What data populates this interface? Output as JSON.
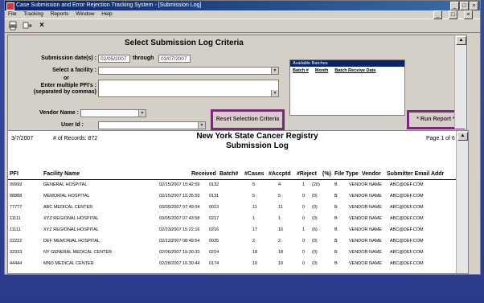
{
  "window": {
    "title": "Case Submission and Error Rejection Tracking System - [Submission Log]"
  },
  "menu": {
    "items": [
      "File",
      "Tracking",
      "Reports",
      "Window",
      "Help"
    ]
  },
  "toolbar": {
    "print_icon": "printer-icon",
    "refresh_icon": "refresh-icon",
    "close_glyph": "×"
  },
  "criteria": {
    "title": "Select Submission Log Criteria",
    "date_label": "Submission date(s) :",
    "date_from": "02/05/2007",
    "through_label": "through",
    "date_to": "03/07/2007",
    "facility_label": "Select a facility :",
    "or_label": "or",
    "pfi_label_1": "Enter multiple PFI's :",
    "pfi_label_2": "(separated by commas)",
    "vendor_label": "Vendor Name :",
    "user_label": "User Id :",
    "batches": {
      "header": "Available Batches",
      "col1": "Batch #",
      "col2": "Month",
      "col3": "Batch Receive Date"
    },
    "reset_label": "Reset Selection Criteria",
    "run_label": "* Run Report *"
  },
  "report": {
    "date": "3/7/2007",
    "records_label": "# of Records:",
    "records_value": "872",
    "title_line1": "New York State Cancer Registry",
    "title_line2": "Submission Log",
    "page": "Page 1 of 6",
    "columns": [
      "PFI",
      "Facility Name",
      "Received",
      "Batch#",
      "#Cases",
      "#Accptd",
      "#Reject",
      "(%)",
      "File Type",
      "Vendor",
      "Submitter Email Addr"
    ],
    "rows": [
      [
        "99999",
        "GENERAL HOSPITAL",
        "02/15/2007 15:42:59",
        "0132",
        "5",
        "4",
        "1",
        "(20)",
        "B",
        "VENDOR NAME",
        "ABC@DEF.COM"
      ],
      [
        "88888",
        "MEMORIAL HOSPITAL",
        "02/15/2007 15:35:53",
        "0131",
        "5",
        "5",
        "0",
        "(0)",
        "B",
        "VENDOR NAME",
        "ABC@DEF.COM"
      ],
      [
        "77777",
        "ABC MEDICAL CENTER",
        "03/05/2007 07:49:04",
        "0013",
        "11",
        "11",
        "0",
        "(0)",
        "B",
        "VENDOR NAME",
        "ABC@DEF.COM"
      ],
      [
        "11111",
        "XYZ REGIONAL HOSPITAL",
        "03/05/2007 07:43:58",
        "0217",
        "1",
        "1",
        "0",
        "(0)",
        "B",
        "VENDOR NAME",
        "ABC@DEF.COM"
      ],
      [
        "11111",
        "XYZ REGIONAL HOSPITAL",
        "02/23/2007 15:22:16",
        "0216",
        "17",
        "16",
        "1",
        "(6)",
        "B",
        "VENDOR NAME",
        "ABC@DEF.COM"
      ],
      [
        "22222",
        "DEF MEMORIAL HOSPITAL",
        "02/12/2007 08:49:54",
        "0035",
        "2",
        "2",
        "0",
        "(0)",
        "B",
        "VENDOR NAME",
        "ABC@DEF.COM"
      ],
      [
        "33333",
        "NY GENERAL MEDICAL CENTER",
        "02/06/2007 15:30:33",
        "0214",
        "18",
        "18",
        "0",
        "(0)",
        "B",
        "VENDOR NAME",
        "ABC@DEF.COM"
      ],
      [
        "44444",
        "MNO MEDICAL CENTER",
        "02/28/2007 16:30:44",
        "0174",
        "10",
        "10",
        "0",
        "(0)",
        "B",
        "VENDOR NAME",
        "ABC@DEF.COM"
      ]
    ]
  }
}
